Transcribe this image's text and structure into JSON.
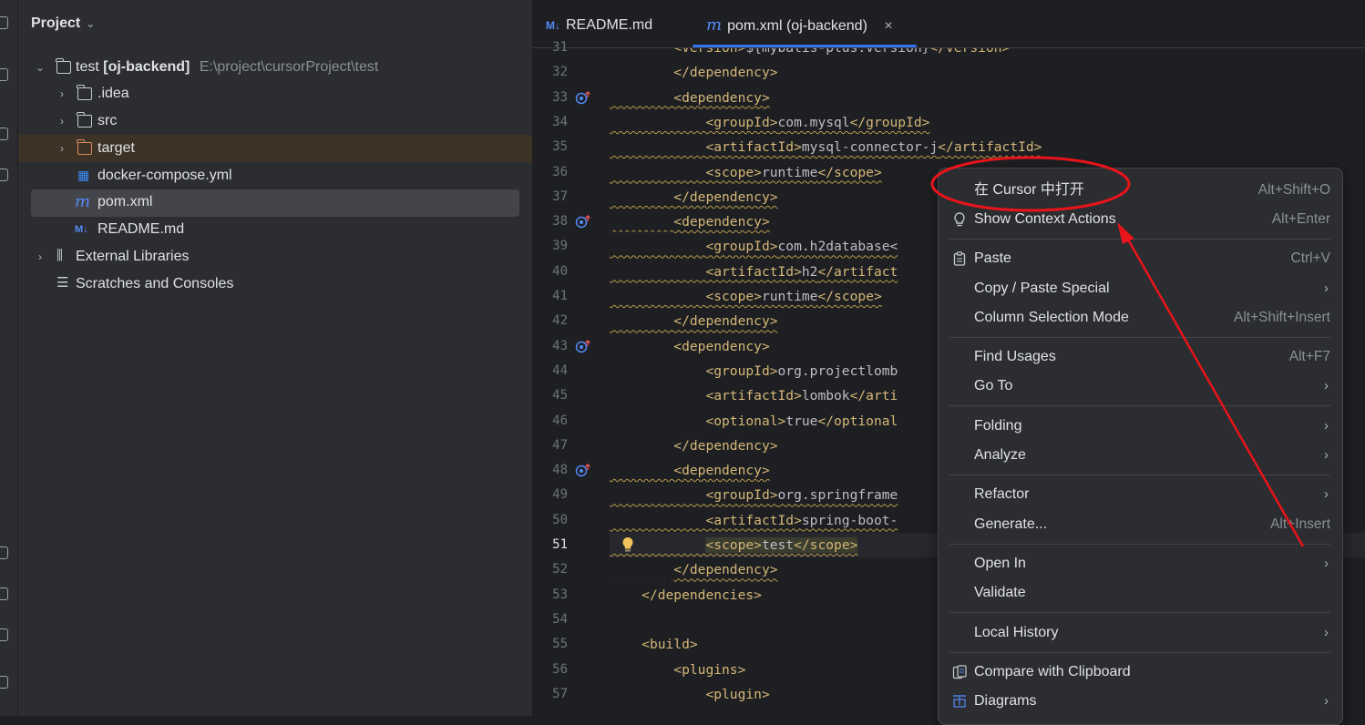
{
  "project_panel": {
    "title": "Project",
    "root_name": "test",
    "root_module": "[oj-backend]",
    "root_path": "E:\\project\\cursorProject\\test",
    "items": [
      {
        "label": ".idea"
      },
      {
        "label": "src"
      },
      {
        "label": "target"
      },
      {
        "label": "docker-compose.yml"
      },
      {
        "label": "pom.xml"
      },
      {
        "label": "README.md"
      },
      {
        "label": "External Libraries"
      },
      {
        "label": "Scratches and Consoles"
      }
    ]
  },
  "tabs": [
    {
      "label": "README.md",
      "icon": "M↓",
      "active": false
    },
    {
      "label": "pom.xml (oj-backend)",
      "icon": "m",
      "active": true,
      "close": "×"
    }
  ],
  "editor": {
    "current_line": "51",
    "lines": [
      {
        "n": "31",
        "t": "        <version>${mybatis-plus.version}</version>"
      },
      {
        "n": "32",
        "t": "        </dependency>"
      },
      {
        "n": "33",
        "t": "        <dependency>"
      },
      {
        "n": "34",
        "t": "            <groupId>com.mysql</groupId>"
      },
      {
        "n": "35",
        "t": "            <artifactId>mysql-connector-j</artifactId>"
      },
      {
        "n": "36",
        "t": "            <scope>runtime</scope>"
      },
      {
        "n": "37",
        "t": "        </dependency>"
      },
      {
        "n": "38",
        "t": "        <dependency>"
      },
      {
        "n": "39",
        "t": "            <groupId>com.h2database<"
      },
      {
        "n": "40",
        "t": "            <artifactId>h2</artifact"
      },
      {
        "n": "41",
        "t": "            <scope>runtime</scope>"
      },
      {
        "n": "42",
        "t": "        </dependency>"
      },
      {
        "n": "43",
        "t": "        <dependency>"
      },
      {
        "n": "44",
        "t": "            <groupId>org.projectlomb"
      },
      {
        "n": "45",
        "t": "            <artifactId>lombok</arti"
      },
      {
        "n": "46",
        "t": "            <optional>true</optional"
      },
      {
        "n": "47",
        "t": "        </dependency>"
      },
      {
        "n": "48",
        "t": "        <dependency>"
      },
      {
        "n": "49",
        "t": "            <groupId>org.springframe"
      },
      {
        "n": "50",
        "t": "            <artifactId>spring-boot-"
      },
      {
        "n": "51",
        "t": "            <scope>test</scope>"
      },
      {
        "n": "52",
        "t": "        </dependency>"
      },
      {
        "n": "53",
        "t": "    </dependencies>"
      },
      {
        "n": "54",
        "t": ""
      },
      {
        "n": "55",
        "t": "    <build>"
      },
      {
        "n": "56",
        "t": "        <plugins>"
      },
      {
        "n": "57",
        "t": "            <plugin>"
      }
    ]
  },
  "context_menu": {
    "items": [
      {
        "label": "在 Cursor 中打开",
        "shortcut": "Alt+Shift+O"
      },
      {
        "label": "Show Context Actions",
        "shortcut": "Alt+Enter",
        "icon": "lightbulb-icon"
      },
      {
        "label": "Paste",
        "shortcut": "Ctrl+V",
        "icon": "clipboard-icon"
      },
      {
        "label": "Copy / Paste Special",
        "submenu": "›"
      },
      {
        "label": "Column Selection Mode",
        "shortcut": "Alt+Shift+Insert"
      },
      {
        "label": "Find Usages",
        "shortcut": "Alt+F7"
      },
      {
        "label": "Go To",
        "submenu": "›"
      },
      {
        "label": "Folding",
        "submenu": "›"
      },
      {
        "label": "Analyze",
        "submenu": "›"
      },
      {
        "label": "Refactor",
        "submenu": "›"
      },
      {
        "label": "Generate...",
        "shortcut": "Alt+Insert"
      },
      {
        "label": "Open In",
        "submenu": "›"
      },
      {
        "label": "Validate"
      },
      {
        "label": "Local History",
        "submenu": "›"
      },
      {
        "label": "Compare with Clipboard",
        "icon": "compare-icon"
      },
      {
        "label": "Diagrams",
        "submenu": "›",
        "icon": "diagram-icon"
      }
    ]
  },
  "colors": {
    "annotation": "#e8141b",
    "accent": "#3574f0"
  }
}
